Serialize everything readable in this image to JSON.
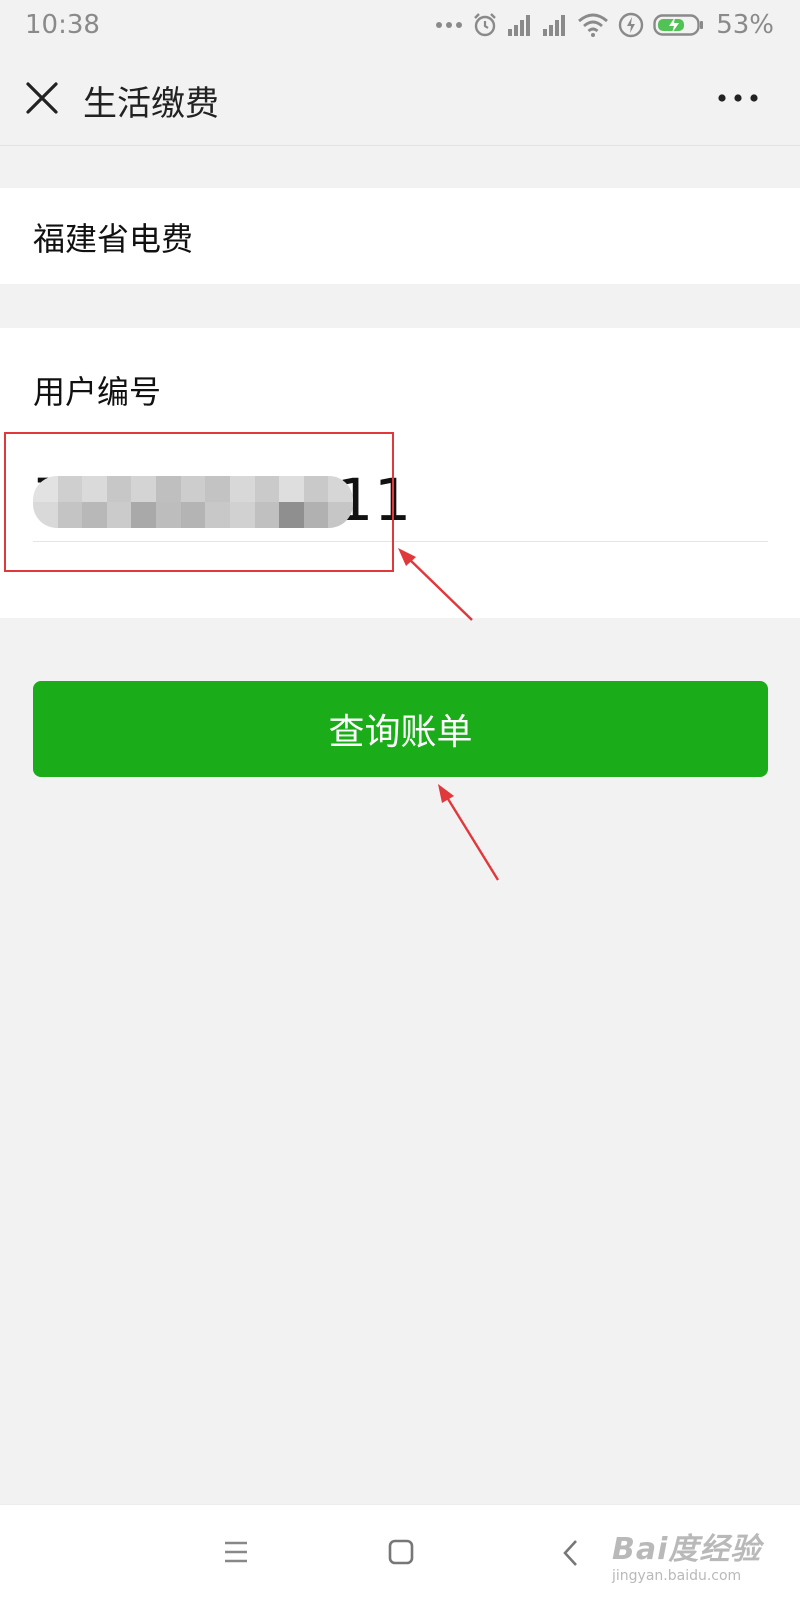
{
  "status_bar": {
    "time": "10:38",
    "battery_percent": "53%",
    "icons": [
      "more-dots-icon",
      "alarm-icon",
      "signal-icon",
      "signal-icon",
      "wifi-icon",
      "charging-icon",
      "battery-icon"
    ]
  },
  "nav": {
    "title": "生活缴费",
    "close_icon": "close-icon",
    "more_icon": "more-icon"
  },
  "provider": {
    "name": "福建省电费"
  },
  "account": {
    "label": "用户编号",
    "value": "7000010711"
  },
  "actions": {
    "query_label": "查询账单"
  },
  "watermark": {
    "logo": "Bai度经验",
    "url": "jingyan.baidu.com"
  },
  "colors": {
    "background": "#f2f2f2",
    "primary_green": "#1aad19",
    "annotation_red": "#e0383b"
  }
}
